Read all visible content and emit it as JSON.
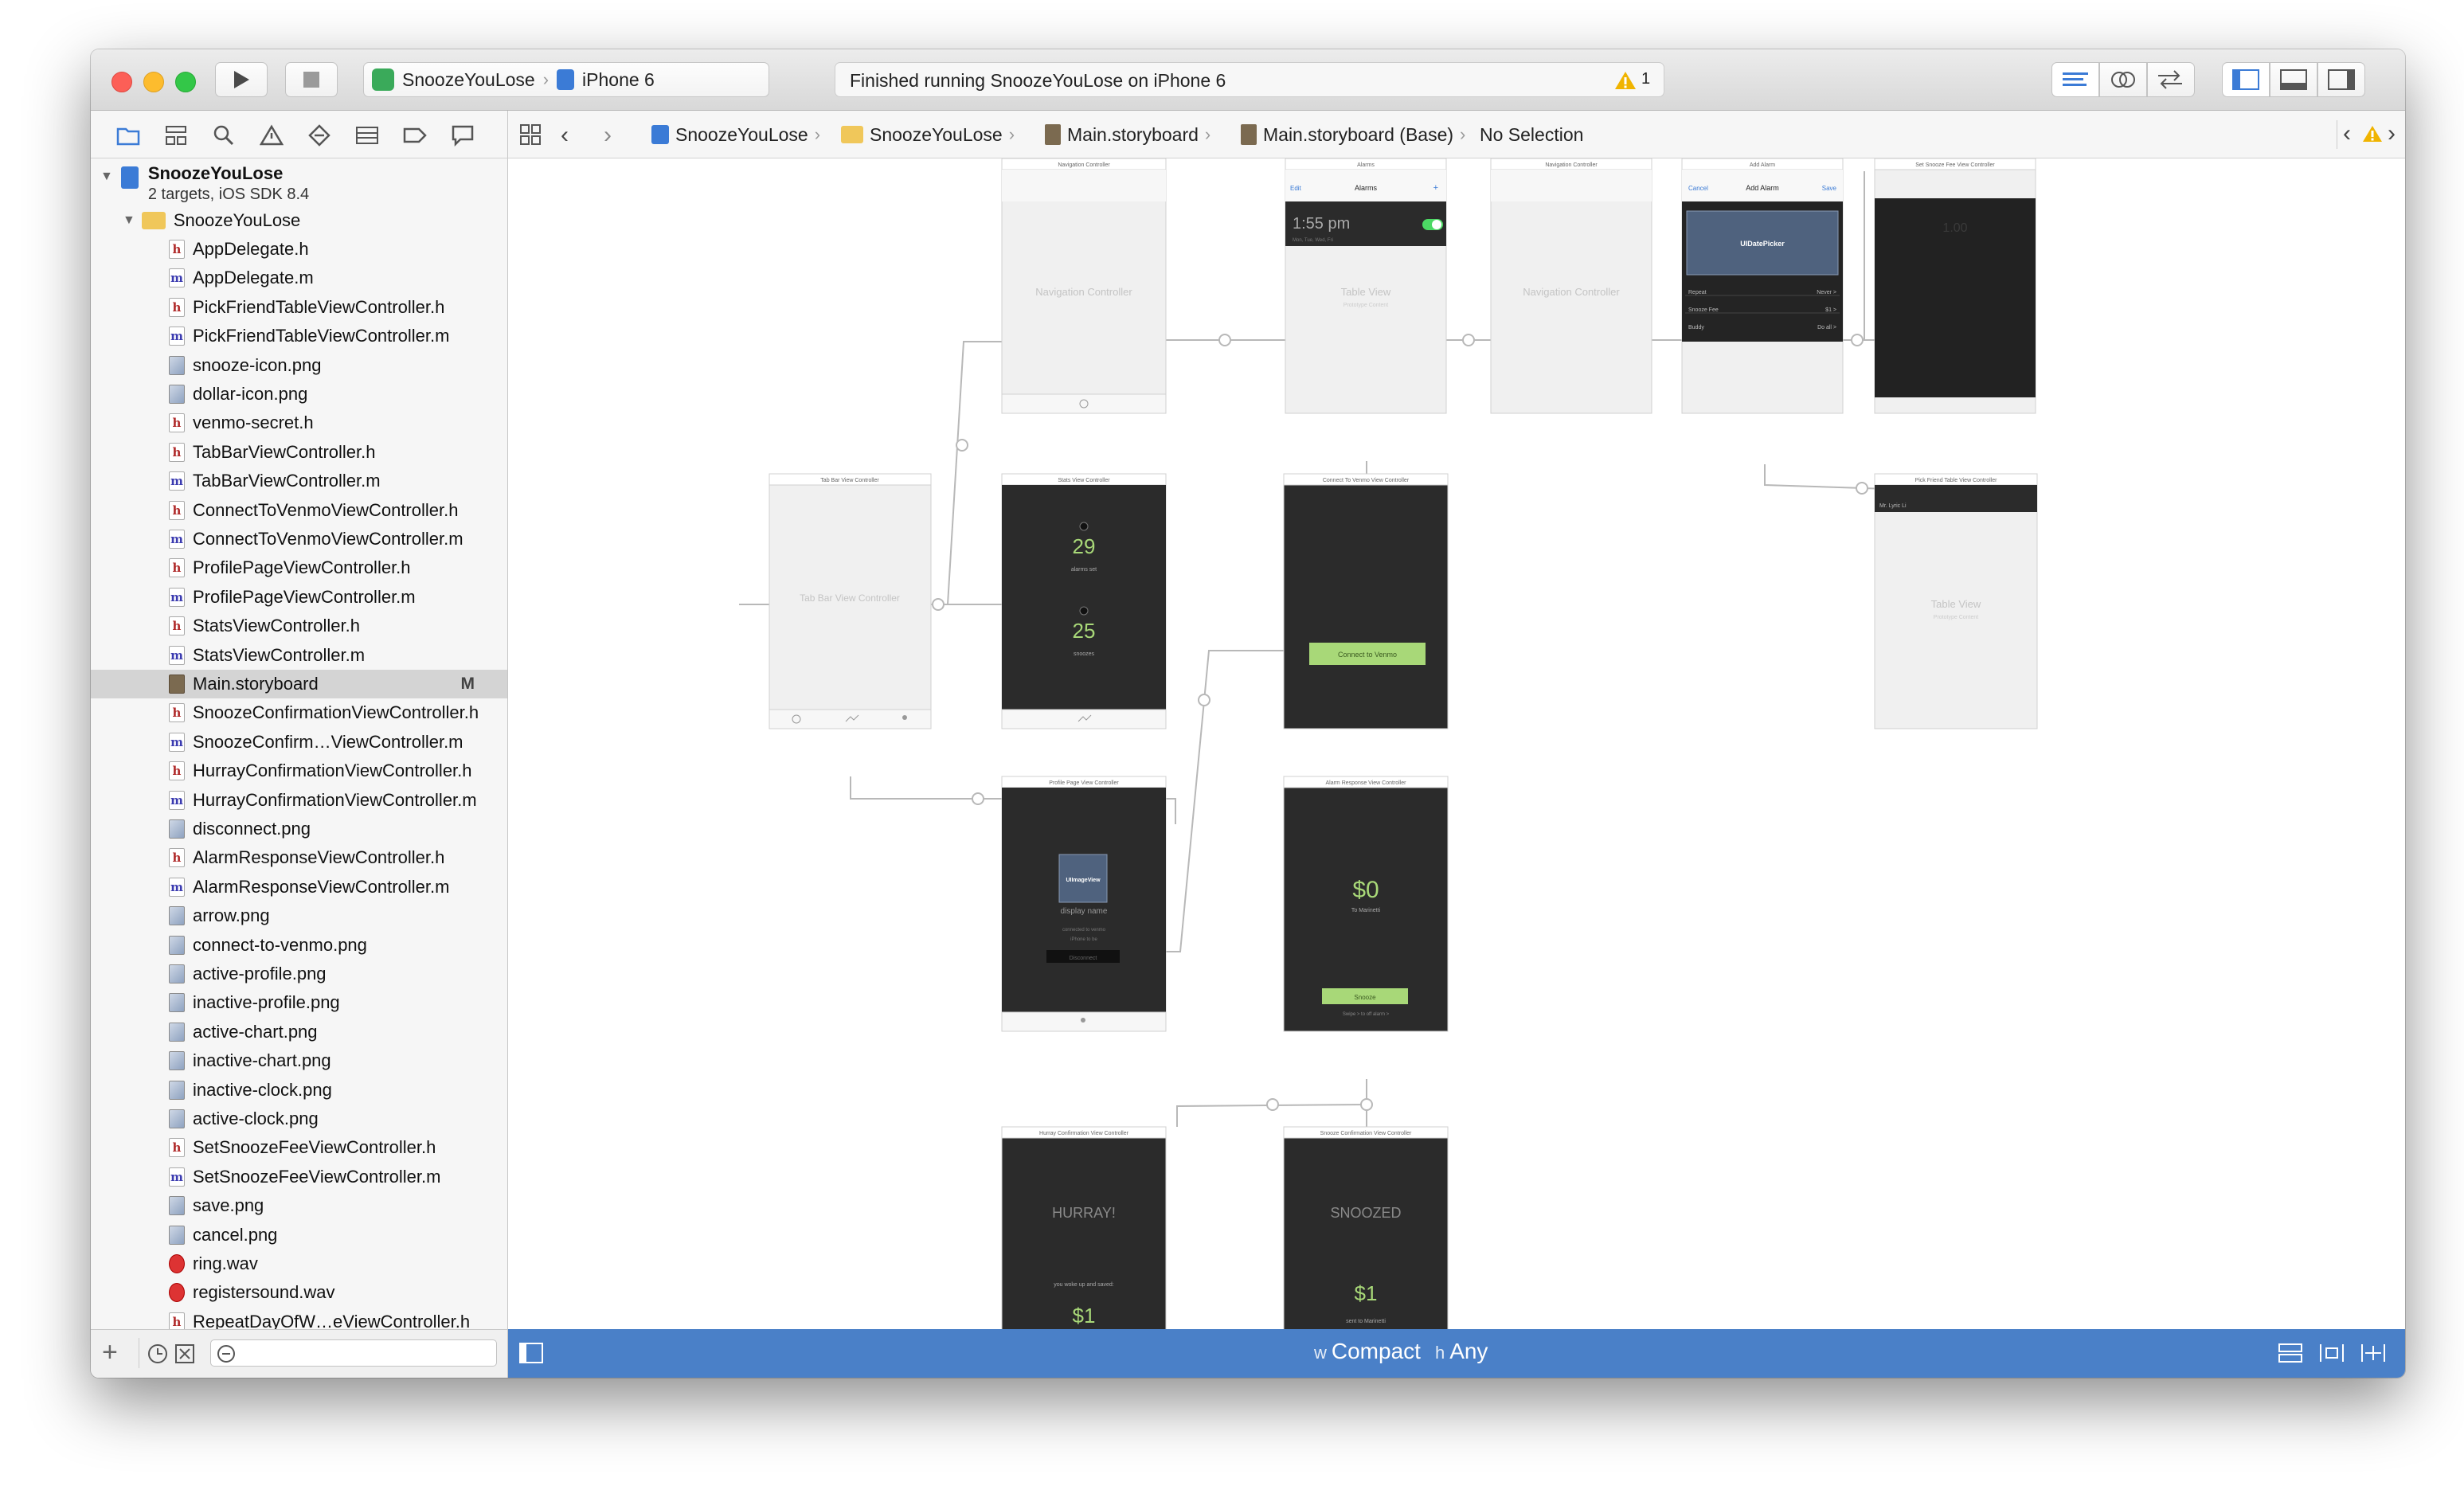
{
  "toolbar": {
    "scheme_target": "SnoozeYouLose",
    "scheme_device": "iPhone 6",
    "status_text": "Finished running SnoozeYouLose on iPhone 6",
    "warning_count": "1"
  },
  "jumpbar": {
    "crumbs": [
      "SnoozeYouLose",
      "SnoozeYouLose",
      "Main.storyboard",
      "Main.storyboard (Base)",
      "No Selection"
    ]
  },
  "navigator": {
    "project_name": "SnoozeYouLose",
    "project_subtitle": "2 targets, iOS SDK 8.4",
    "group_name": "SnoozeYouLose",
    "files": [
      {
        "name": "AppDelegate.h",
        "type": "h"
      },
      {
        "name": "AppDelegate.m",
        "type": "m"
      },
      {
        "name": "PickFriendTableViewController.h",
        "type": "h"
      },
      {
        "name": "PickFriendTableViewController.m",
        "type": "m"
      },
      {
        "name": "snooze-icon.png",
        "type": "png"
      },
      {
        "name": "dollar-icon.png",
        "type": "png"
      },
      {
        "name": "venmo-secret.h",
        "type": "h"
      },
      {
        "name": "TabBarViewController.h",
        "type": "h"
      },
      {
        "name": "TabBarViewController.m",
        "type": "m"
      },
      {
        "name": "ConnectToVenmoViewController.h",
        "type": "h"
      },
      {
        "name": "ConnectToVenmoViewController.m",
        "type": "m"
      },
      {
        "name": "ProfilePageViewController.h",
        "type": "h"
      },
      {
        "name": "ProfilePageViewController.m",
        "type": "m"
      },
      {
        "name": "StatsViewController.h",
        "type": "h"
      },
      {
        "name": "StatsViewController.m",
        "type": "m"
      },
      {
        "name": "Main.storyboard",
        "type": "sb",
        "badge": "M"
      },
      {
        "name": "SnoozeConfirmationViewController.h",
        "type": "h"
      },
      {
        "name": "SnoozeConfirm…ViewController.m",
        "type": "m"
      },
      {
        "name": "HurrayConfirmationViewController.h",
        "type": "h"
      },
      {
        "name": "HurrayConfirmationViewController.m",
        "type": "m"
      },
      {
        "name": "disconnect.png",
        "type": "png"
      },
      {
        "name": "AlarmResponseViewController.h",
        "type": "h"
      },
      {
        "name": "AlarmResponseViewController.m",
        "type": "m"
      },
      {
        "name": "arrow.png",
        "type": "png"
      },
      {
        "name": "connect-to-venmo.png",
        "type": "png"
      },
      {
        "name": "active-profile.png",
        "type": "png"
      },
      {
        "name": "inactive-profile.png",
        "type": "png"
      },
      {
        "name": "active-chart.png",
        "type": "png"
      },
      {
        "name": "inactive-chart.png",
        "type": "png"
      },
      {
        "name": "inactive-clock.png",
        "type": "png"
      },
      {
        "name": "active-clock.png",
        "type": "png"
      },
      {
        "name": "SetSnoozeFeeViewController.h",
        "type": "h"
      },
      {
        "name": "SetSnoozeFeeViewController.m",
        "type": "m"
      },
      {
        "name": "save.png",
        "type": "png"
      },
      {
        "name": "cancel.png",
        "type": "png"
      },
      {
        "name": "ring.wav",
        "type": "wav"
      },
      {
        "name": "registersound.wav",
        "type": "wav"
      },
      {
        "name": "RepeatDayOfW…eViewController.h",
        "type": "h"
      }
    ]
  },
  "storyboard": {
    "scenes": {
      "nav1": {
        "title": "Navigation Controller",
        "body": "Navigation Controller"
      },
      "alarms": {
        "title": "Alarms",
        "nav_title": "Alarms",
        "edit": "Edit",
        "plus": "+",
        "time": "1:55 pm",
        "sub": "Mon, Tue, Wed, Fri",
        "body": "Table View",
        "body_sub": "Prototype Content"
      },
      "nav2": {
        "title": "Navigation Controller",
        "body": "Navigation Controller"
      },
      "addalarm": {
        "title": "Add Alarm",
        "cancel": "Cancel",
        "nav_title": "Add Alarm",
        "save": "Save",
        "picker": "UIDatePicker",
        "rows": [
          [
            "Repeat",
            "Never >"
          ],
          [
            "Snooze Fee",
            "$1 >"
          ],
          [
            "Buddy",
            "Do all >"
          ]
        ]
      },
      "snoozefee": {
        "title": "Set Snooze Fee View Controller",
        "value": "1.00"
      },
      "tabbar": {
        "title": "Tab Bar View Controller",
        "body": "Tab Bar View Controller"
      },
      "stats": {
        "title": "Stats View Controller",
        "num1": "29",
        "lbl1": "alarms set",
        "num2": "25",
        "lbl2": "snoozes"
      },
      "connect": {
        "title": "Connect To Venmo View Controller",
        "button": "Connect to Venmo"
      },
      "pickfriend": {
        "title": "Pick Friend Table View Controller",
        "cell": "Mr. Lyric Li",
        "body": "Table View",
        "body_sub": "Prototype Content"
      },
      "profile": {
        "title": "Profile Page View Controller",
        "image": "UIImageView",
        "name": "display name",
        "line1": "connected to venmo",
        "line2": "iPhone to be",
        "button": "Disconnect"
      },
      "alarmresp": {
        "title": "Alarm Response View Controller",
        "amount": "$0",
        "to": "To Marinetti",
        "button": "Snooze",
        "foot": "Swipe > to off alarm >"
      },
      "hurray": {
        "title": "Hurray Confirmation View Controller",
        "big": "HURRAY!",
        "line": "you woke up and saved:",
        "amount": "$1"
      },
      "snoozed": {
        "title": "Snooze Confirmation View Controller",
        "big": "SNOOZED",
        "amount": "$1",
        "line": "sent to Marinetti"
      }
    }
  },
  "bottombar": {
    "w_prefix": "w",
    "w_value": "Compact",
    "h_prefix": "h",
    "h_value": "Any"
  },
  "colors": {
    "accent_blue": "#4a80c8",
    "scene_dark": "#2b2b2b",
    "scene_light": "#efefef",
    "green": "#a8d878",
    "warning": "#f0b400"
  }
}
